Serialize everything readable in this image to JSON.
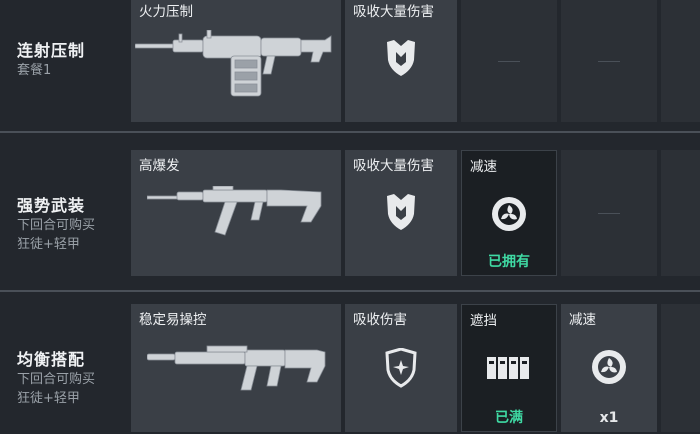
{
  "rows": [
    {
      "title": "连射压制",
      "sub1": "套餐1",
      "sub2": "",
      "weapon": "火力压制",
      "armor": "吸收大量伤害"
    },
    {
      "title": "强势武装",
      "sub1": "下回合可购买",
      "sub2": "狂徒+轻甲",
      "weapon": "高爆发",
      "armor": "吸收大量伤害",
      "ability1": "减速",
      "ability1_status": "已拥有"
    },
    {
      "title": "均衡搭配",
      "sub1": "下回合可购买",
      "sub2": "狂徒+轻甲",
      "weapon": "稳定易操控",
      "armor": "吸收伤害",
      "ability1": "遮挡",
      "ability1_status": "已满",
      "ability2": "减速",
      "ability2_count": "x1"
    }
  ],
  "colors": {
    "status": "#3fd9a3",
    "background": "#23272d",
    "card": "#3a3f46"
  }
}
